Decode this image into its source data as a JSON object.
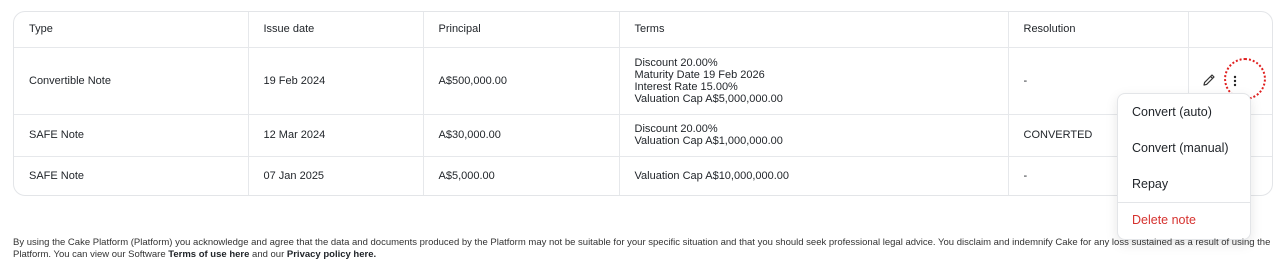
{
  "table": {
    "headers": [
      "Type",
      "Issue date",
      "Principal",
      "Terms",
      "Resolution"
    ],
    "rows": [
      {
        "type": "Convertible Note",
        "issue_date": "19 Feb 2024",
        "principal": "A$500,000.00",
        "terms": [
          "Discount 20.00%",
          "Maturity Date 19 Feb 2026",
          "Interest Rate 15.00%",
          "Valuation Cap A$5,000,000.00"
        ],
        "resolution": "-"
      },
      {
        "type": "SAFE Note",
        "issue_date": "12 Mar 2024",
        "principal": "A$30,000.00",
        "terms": [
          "Discount 20.00%",
          "Valuation Cap A$1,000,000.00"
        ],
        "resolution": "CONVERTED"
      },
      {
        "type": "SAFE Note",
        "issue_date": "07 Jan 2025",
        "principal": "A$5,000.00",
        "terms": [
          "Valuation Cap A$10,000,000.00"
        ],
        "resolution": "-"
      }
    ]
  },
  "actions": {
    "edit_icon": "pencil-icon",
    "more_icon": "kebab-menu-icon"
  },
  "menu": {
    "items": [
      "Convert (auto)",
      "Convert (manual)",
      "Repay"
    ],
    "danger_item": "Delete note",
    "danger_color": "#d6322f"
  },
  "highlight_color": "#e02020",
  "disclaimer": {
    "text_1": "By using the Cake Platform (Platform) you acknowledge and agree that the data and documents produced by the Platform may not be suitable for your specific situation and that you should seek professional legal advice. You disclaim and indemnify Cake for any loss sustained as a result of using the Platform. You can view our Software ",
    "terms_link": "Terms of use here",
    "text_2": " and our ",
    "privacy_link": "Privacy policy here."
  }
}
